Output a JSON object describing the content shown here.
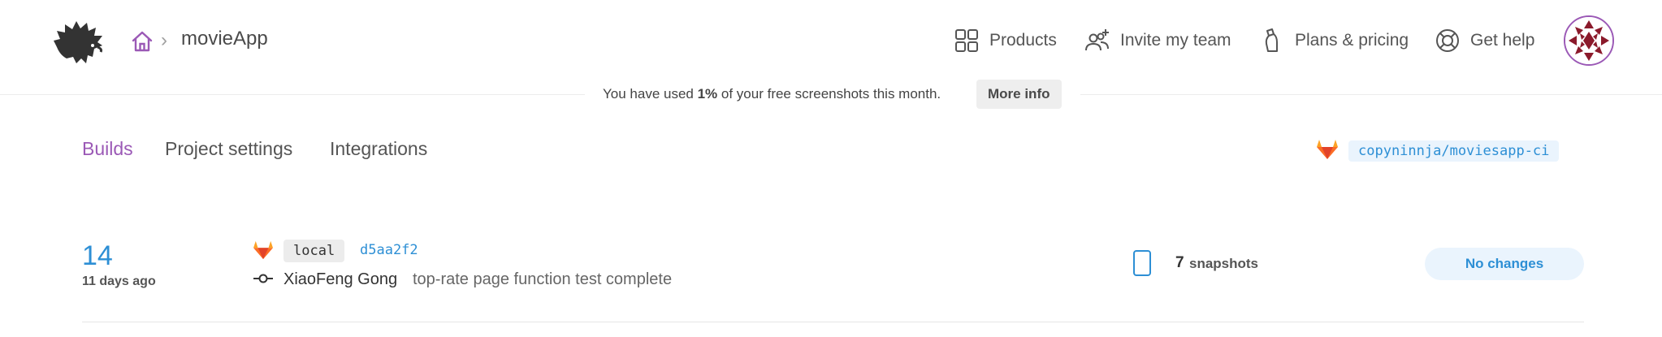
{
  "header": {
    "project_name": "movieApp",
    "breadcrumb_separator": "›",
    "nav": [
      {
        "label": "Products",
        "icon": "grid-icon"
      },
      {
        "label": "Invite my team",
        "icon": "add-people-icon"
      },
      {
        "label": "Plans & pricing",
        "icon": "bottle-icon"
      },
      {
        "label": "Get help",
        "icon": "lifebuoy-icon"
      }
    ],
    "avatar_icon": "avatar-pattern-icon"
  },
  "banner": {
    "prefix": "You have used ",
    "percent": "1%",
    "suffix": " of your free screenshots this month.",
    "button": "More info"
  },
  "tabs": [
    {
      "label": "Builds",
      "active": true
    },
    {
      "label": "Project settings",
      "active": false
    },
    {
      "label": "Integrations",
      "active": false
    }
  ],
  "repo": {
    "icon": "gitlab-icon",
    "name": "copyninnja/moviesapp-ci"
  },
  "builds": [
    {
      "number": "14",
      "time": "11 days ago",
      "branch": "local",
      "hash": "d5aa2f2",
      "author": "XiaoFeng Gong",
      "message": "top-rate page function test complete",
      "snapshot_count": "7",
      "snapshot_label": "snapshots",
      "status": "No changes"
    }
  ],
  "colors": {
    "accent_purple": "#9b59b6",
    "link_blue": "#2d8fd5",
    "badge_blue_bg": "#eaf4fd"
  }
}
